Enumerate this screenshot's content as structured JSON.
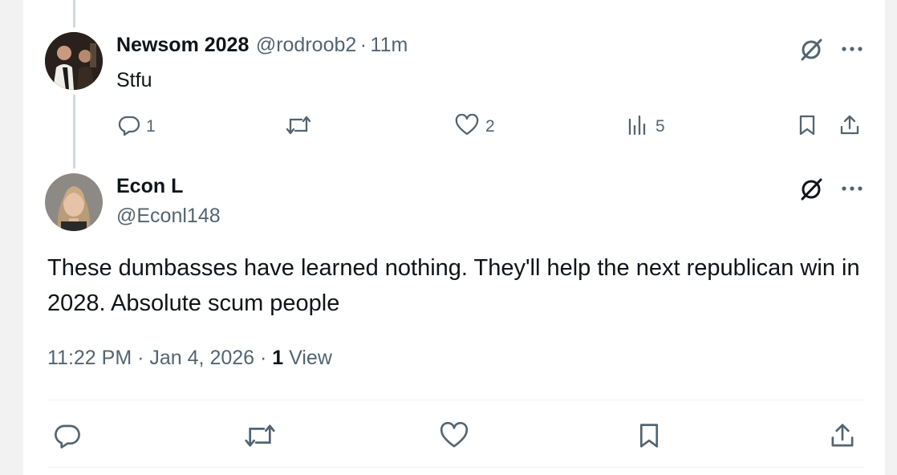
{
  "reply": {
    "name": "Newsom 2028",
    "handle": "@rodroob2",
    "separator": "·",
    "time": "11m",
    "text": "Stfu",
    "actions": {
      "reply_count": "1",
      "repost_count": "",
      "like_count": "2",
      "views_count": "5"
    }
  },
  "main": {
    "name": "Econ L",
    "handle": "@Econl148",
    "text": "These dumbasses have learned nothing. They'll help the next republican win in 2028. Absolute scum people",
    "meta": {
      "time": "11:22 PM",
      "separator": "·",
      "date": "Jan 4, 2026",
      "views_count": "1",
      "views_label": "View"
    }
  },
  "colors": {
    "text_primary": "#0f1419",
    "text_secondary": "#536471",
    "divider": "#eff3f4",
    "thread_line": "#cfd9de"
  },
  "icons": [
    "grok-icon",
    "more-icon",
    "reply-icon",
    "repost-icon",
    "like-icon",
    "views-icon",
    "bookmark-icon",
    "share-icon"
  ]
}
